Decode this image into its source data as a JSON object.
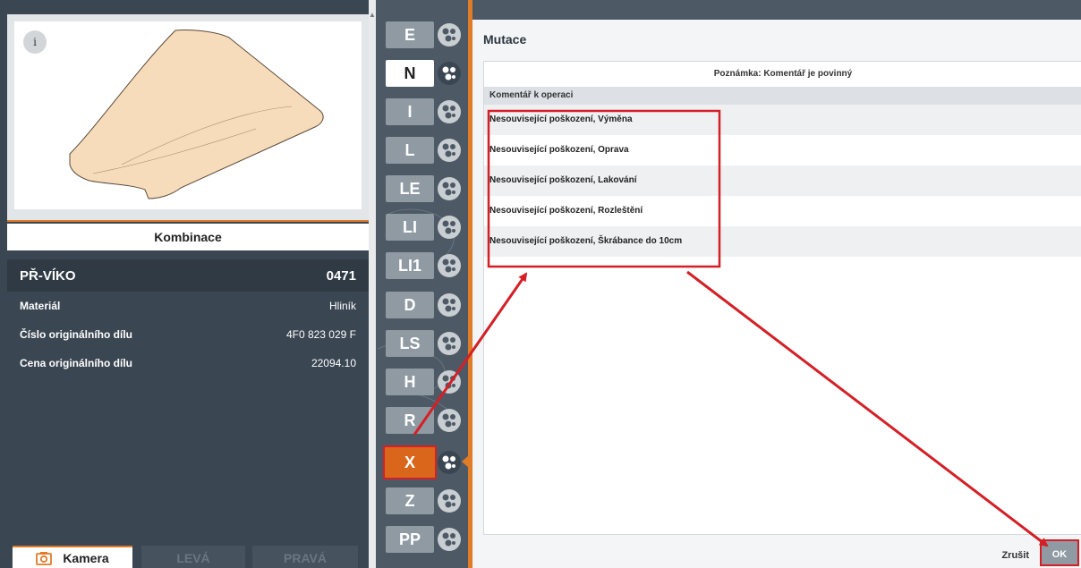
{
  "left_panel": {
    "info_label": "i",
    "combination_label": "Kombinace",
    "part": {
      "name": "PŘ-VÍKO",
      "code": "0471"
    },
    "details": [
      {
        "label": "Materiál",
        "value": "Hliník"
      },
      {
        "label": "Číslo originálního dílu",
        "value": "4F0 823 029 F"
      },
      {
        "label": "Cena originálního dílu",
        "value": "22094.10"
      }
    ],
    "buttons": {
      "camera": "Kamera",
      "left": "LEVÁ",
      "right": "PRAVÁ"
    }
  },
  "strip": {
    "codes": [
      "E",
      "N",
      "I",
      "L",
      "LE",
      "LI",
      "LI1",
      "D",
      "LS",
      "H",
      "R",
      "X",
      "Z",
      "PP"
    ],
    "active_code": "N",
    "selected_code": "X"
  },
  "dialog": {
    "title": "Mutace",
    "note": "Poznámka: Komentář je povinný",
    "list_header": "Komentář k operaci",
    "items": [
      "Nesouvisející poškození, Výměna",
      "Nesouvisející poškození, Oprava",
      "Nesouvisející poškození, Lakování",
      "Nesouvisející poškození, Rozleštění",
      "Nesouvisející poškození, Škrábance do 10cm"
    ],
    "cancel_label": "Zrušit",
    "ok_label": "OK"
  },
  "colors": {
    "accent": "#e07b28",
    "annotation": "#d41f26",
    "panel_dark": "#3a4652"
  }
}
